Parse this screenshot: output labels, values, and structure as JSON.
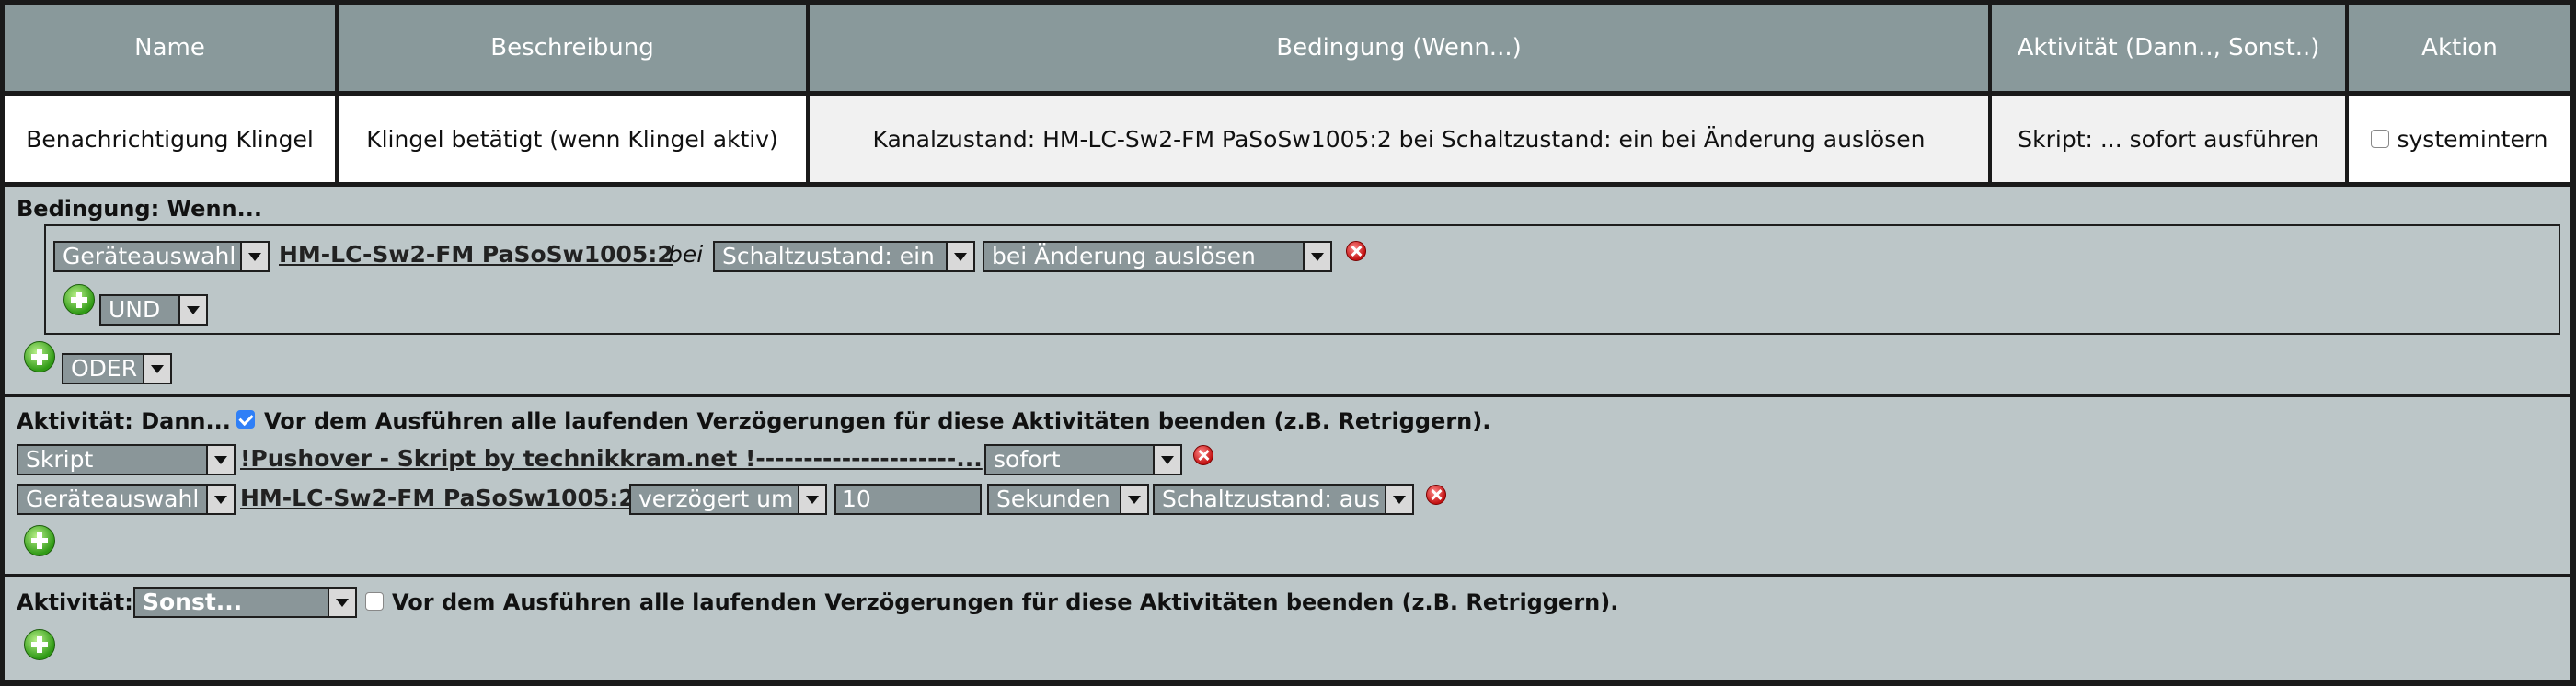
{
  "header": {
    "name": "Name",
    "beschreibung": "Beschreibung",
    "bedingung": "Bedingung (Wenn...)",
    "aktivitaet": "Aktivität (Dann.., Sonst..)",
    "aktion": "Aktion"
  },
  "row": {
    "name": "Benachrichtigung Klingel",
    "beschreibung": "Klingel betätigt (wenn Klingel aktiv)",
    "bedingung": "Kanalzustand: HM-LC-Sw2-FM PaSoSw1005:2 bei Schaltzustand: ein bei Änderung auslösen",
    "aktivitaet": "Skript: ... sofort ausführen",
    "systemintern_label": "systemintern",
    "systemintern_checked": false
  },
  "condition": {
    "title": "Bedingung: Wenn...",
    "device_select": "Geräteauswahl",
    "device_link": "HM-LC-Sw2-FM PaSoSw1005:2",
    "bei": "bei",
    "state_select": "Schaltzustand: ein",
    "trigger_select": "bei Änderung auslösen",
    "und_select": "UND",
    "oder_select": "ODER"
  },
  "then": {
    "title": "Aktivität: Dann...",
    "retrigger_checked": true,
    "retrigger_label": "Vor dem Ausführen alle laufenden Verzögerungen für diese Aktivitäten beenden (z.B. Retriggern).",
    "line1": {
      "type_select": "Skript",
      "link": "!Pushover - Skript by technikkram.net !---------------------...",
      "timing_select": "sofort"
    },
    "line2": {
      "type_select": "Geräteauswahl",
      "link": "HM-LC-Sw2-FM PaSoSw1005:2",
      "timing_select": "verzögert um",
      "delay_value": "10",
      "unit_select": "Sekunden",
      "state_select": "Schaltzustand: aus"
    }
  },
  "else": {
    "title": "Aktivität:",
    "mode_select": "Sonst...",
    "retrigger_checked": false,
    "retrigger_label": "Vor dem Ausführen alle laufenden Verzögerungen für diese Aktivitäten beenden (z.B. Retriggern)."
  },
  "icons": {
    "add": "green-plus-icon",
    "delete": "red-x-icon",
    "dropdown": "chevron-down-icon"
  },
  "colors": {
    "header_bg": "#89999b",
    "panel_bg": "#bcc6c8",
    "select_bg": "#8a9699",
    "checkbox_checked": "#2f7ff7"
  }
}
